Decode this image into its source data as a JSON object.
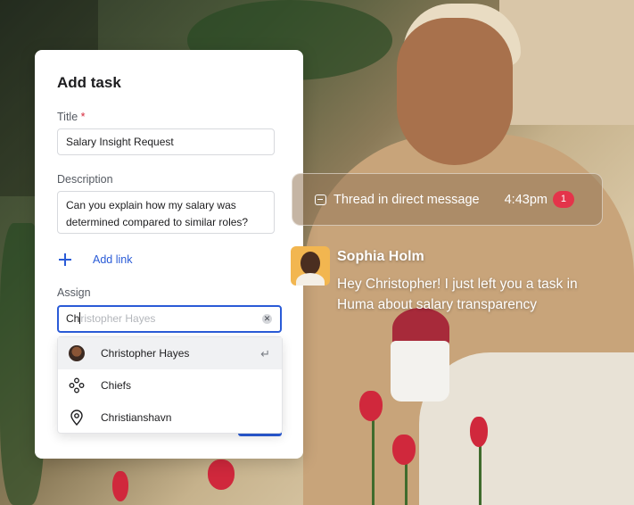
{
  "dialog": {
    "title": "Add task",
    "title_label": "Title",
    "required_marker": "*",
    "title_value": "Salary Insight Request",
    "description_label": "Description",
    "description_value": "Can you explain how my salary was determined compared to similar roles?",
    "add_link_label": "Add link",
    "assign_label": "Assign",
    "assign_typed": "Ch",
    "assign_suggestion": "ristopher Hayes",
    "suggestions": [
      {
        "label": "Christopher Hayes",
        "icon": "avatar"
      },
      {
        "label": "Chiefs",
        "icon": "group-icon"
      },
      {
        "label": "Christianshavn",
        "icon": "location-pin-icon"
      }
    ]
  },
  "thread": {
    "label": "Thread in direct message",
    "time": "4:43pm",
    "unread_count": "1"
  },
  "message": {
    "sender": "Sophia Holm",
    "text": "Hey Christopher! I just left you a task in Huma about salary transparency"
  },
  "colors": {
    "accent": "#2a5bd7",
    "badge": "#e4344a",
    "avatar_bg": "#f2b650"
  }
}
